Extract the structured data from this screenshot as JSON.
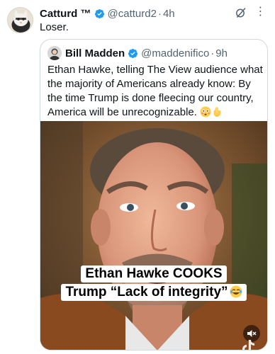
{
  "tweet": {
    "author_name": "Catturd ™",
    "handle": "@catturd2",
    "separator": "·",
    "time": "4h",
    "text": "Loser."
  },
  "quoted": {
    "author_name": "Bill Madden",
    "handle": "@maddenifico",
    "separator": "·",
    "time": "9h",
    "text": "Ethan Hawke, telling The View audience what the majority of Americans already know: By the time Trump is done fleecing our country, America will be unrecognizable.",
    "text_emojis": [
      "flushed-face",
      "pointing-down"
    ]
  },
  "video": {
    "caption_line1": "Ethan Hawke COOKS",
    "caption_line2": "Trump “Lack of integrity”",
    "caption_emoji": "laughing-crying-face",
    "muted": true
  },
  "colors": {
    "text": "#0f1419",
    "secondary": "#536471",
    "verified": "#1d9bf0",
    "border": "#cfd9de"
  }
}
